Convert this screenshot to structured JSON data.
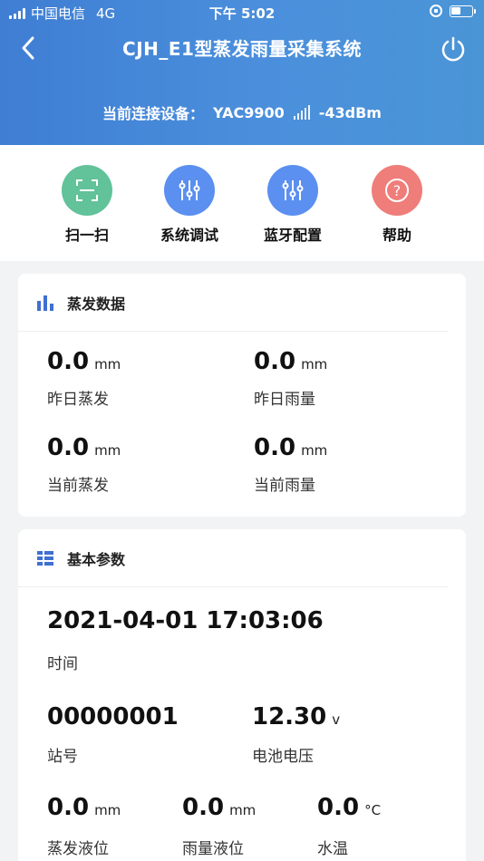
{
  "status_bar": {
    "carrier": "中国电信",
    "network": "4G",
    "time": "下午 5:02"
  },
  "header": {
    "title": "CJH_E1型蒸发雨量采集系统",
    "device_label": "当前连接设备：",
    "device_name": "YAC9900",
    "rssi": "-43dBm"
  },
  "quick_actions": [
    {
      "label": "扫一扫",
      "icon": "scan-icon",
      "color": "#62c29a"
    },
    {
      "label": "系统调试",
      "icon": "sliders-icon",
      "color": "#5b8ff0"
    },
    {
      "label": "蓝牙配置",
      "icon": "sliders-icon",
      "color": "#5b8ff0"
    },
    {
      "label": "帮助",
      "icon": "help-icon",
      "color": "#ef7d7a"
    }
  ],
  "evaporation_card": {
    "title": "蒸发数据",
    "items": [
      {
        "value": "0.0",
        "unit": "mm",
        "label": "昨日蒸发"
      },
      {
        "value": "0.0",
        "unit": "mm",
        "label": "昨日雨量"
      },
      {
        "value": "0.0",
        "unit": "mm",
        "label": "当前蒸发"
      },
      {
        "value": "0.0",
        "unit": "mm",
        "label": "当前雨量"
      }
    ]
  },
  "basic_card": {
    "title": "基本参数",
    "datetime": "2021-04-01 17:03:06",
    "datetime_label": "时间",
    "station": {
      "value": "00000001",
      "label": "站号"
    },
    "battery": {
      "value": "12.30",
      "unit": "v",
      "label": "电池电压"
    },
    "evap_level": {
      "value": "0.0",
      "unit": "mm",
      "label": "蒸发液位"
    },
    "rain_level": {
      "value": "0.0",
      "unit": "mm",
      "label": "雨量液位"
    },
    "water_temp": {
      "value": "0.0",
      "unit": "°C",
      "label": "水温"
    }
  },
  "colors": {
    "header_gradient_start": "#3f7ed3",
    "header_gradient_end": "#4a95d6",
    "accent_blue": "#3f6fd1",
    "scan_green": "#62c29a",
    "config_blue": "#5b8ff0",
    "help_red": "#ef7d7a"
  }
}
